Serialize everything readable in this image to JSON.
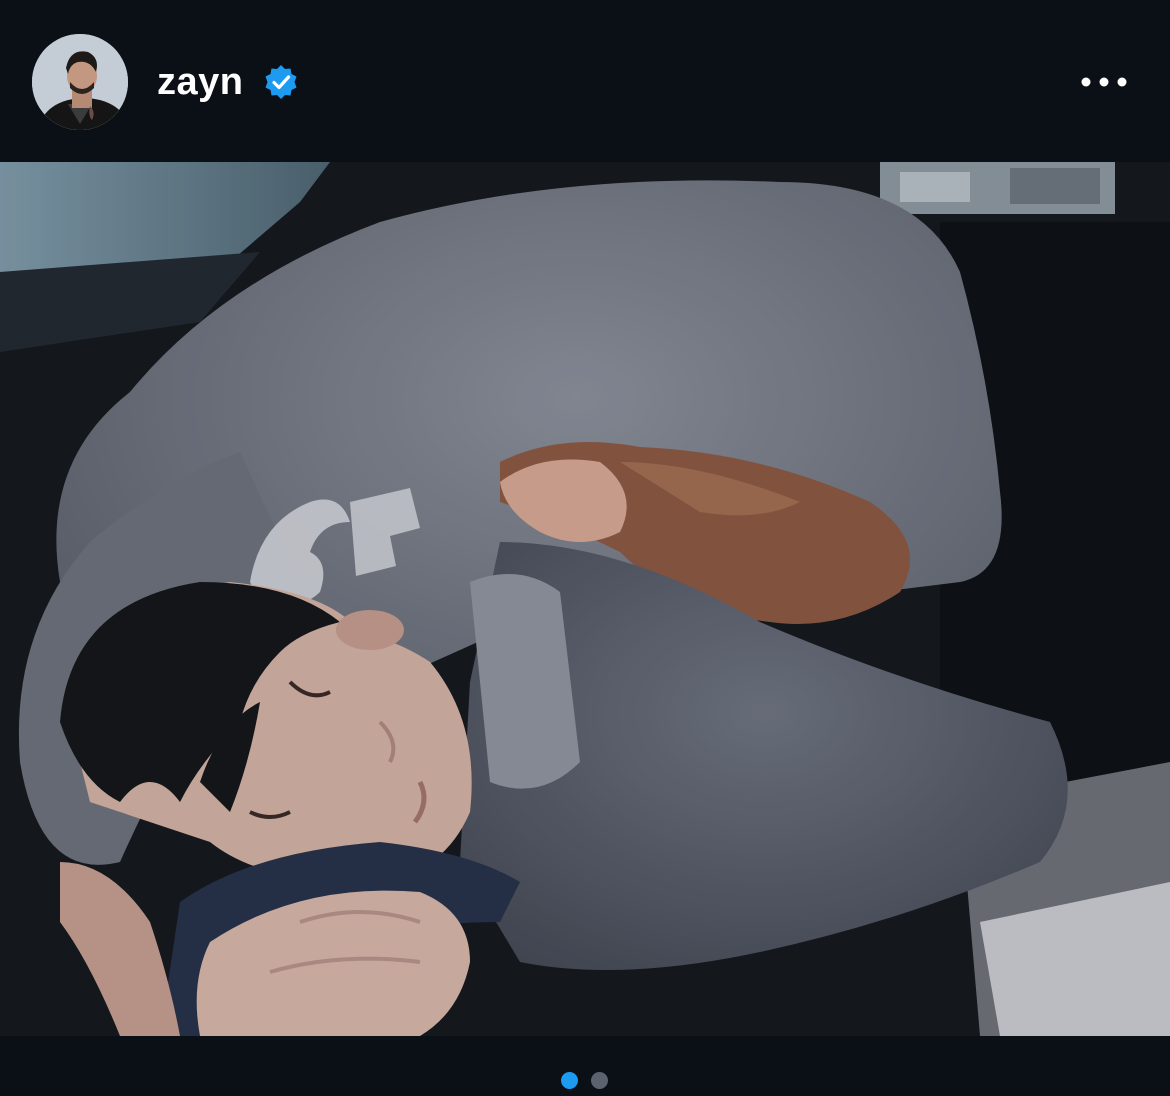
{
  "post": {
    "username": "zayn",
    "verified": true,
    "avatar_icon": "profile-photo",
    "more_icon": "more-horizontal-icon"
  },
  "carousel": {
    "slide_count": 2,
    "active_index": 0,
    "active_color": "#1d9bf0",
    "inactive_color": "#5c636e"
  },
  "colors": {
    "background": "#0b0f16",
    "verified_badge": "#1d9bf0",
    "text": "#ffffff"
  }
}
